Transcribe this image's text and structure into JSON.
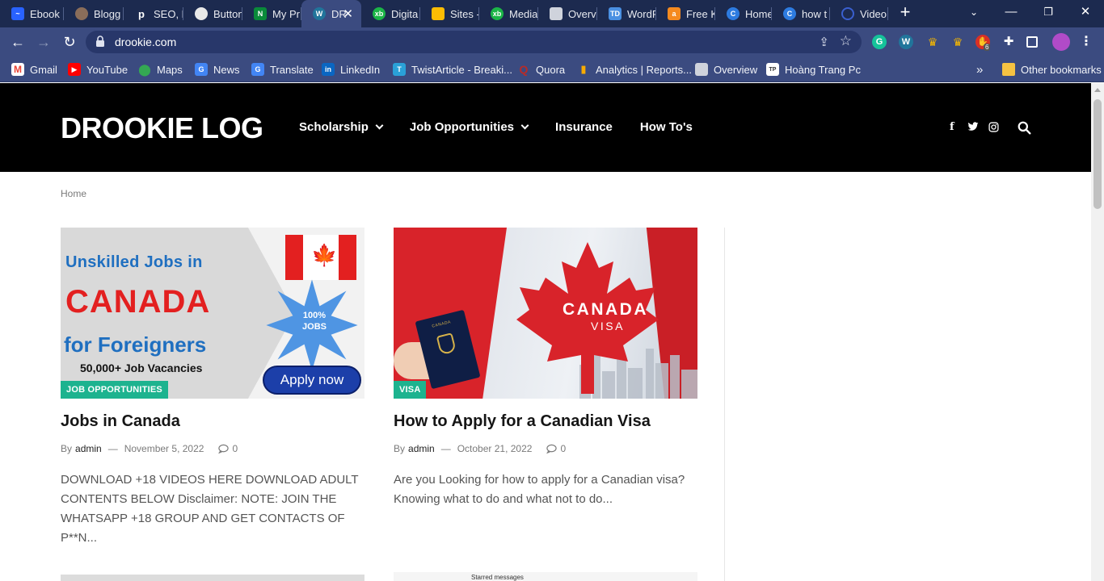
{
  "browser": {
    "tabs": [
      {
        "label": "Ebook",
        "color": "#2962ff"
      },
      {
        "label": "Blogg",
        "color": "#8a6d5a"
      },
      {
        "label": "SEO, E",
        "color": "#1c2a4f"
      },
      {
        "label": "Button",
        "color": "#e8e8e8"
      },
      {
        "label": "My Pr",
        "color": "#0a8a3a"
      },
      {
        "label": "DR",
        "color": "#21759b",
        "active": true
      },
      {
        "label": "Digita",
        "color": "#1bb547"
      },
      {
        "label": "Sites -",
        "color": "#fbbc04"
      },
      {
        "label": "Media",
        "color": "#1bb547"
      },
      {
        "label": "Overv",
        "color": "#cfd3dc"
      },
      {
        "label": "WordP",
        "color": "#4a90e2"
      },
      {
        "label": "Free K",
        "color": "#f58a1f"
      },
      {
        "label": "Home",
        "color": "#2d7be0"
      },
      {
        "label": "how t",
        "color": "#2d7be0"
      },
      {
        "label": "Video",
        "color": "#3a5fcf"
      }
    ],
    "url": "drookie.com",
    "bookmarks": [
      {
        "label": "Gmail",
        "color": "#ea4335",
        "icon": "gmail-icon"
      },
      {
        "label": "YouTube",
        "color": "#ff0000",
        "icon": "youtube-icon"
      },
      {
        "label": "Maps",
        "color": "#34a853",
        "icon": "maps-icon"
      },
      {
        "label": "News",
        "color": "#4285f4",
        "icon": "news-icon"
      },
      {
        "label": "Translate",
        "color": "#4285f4",
        "icon": "translate-icon"
      },
      {
        "label": "LinkedIn",
        "color": "#0a66c2",
        "icon": "linkedin-icon"
      },
      {
        "label": "TwistArticle - Breaki...",
        "color": "#2aa1d8",
        "icon": "twistarticle-icon"
      },
      {
        "label": "Quora",
        "color": "#b92b27",
        "icon": "quora-icon"
      },
      {
        "label": "Analytics | Reports...",
        "color": "#f9ab00",
        "icon": "analytics-icon"
      },
      {
        "label": "Overview",
        "color": "#cfd3dc",
        "icon": "overview-icon"
      },
      {
        "label": "Hoàng Trang Pc",
        "color": "#ffffff",
        "icon": "hoang-trang-icon"
      }
    ],
    "more_bookmarks": "»",
    "other_bookmarks": "Other bookmarks",
    "extension_badge": "6"
  },
  "site": {
    "logo": "DROOKIE LOG",
    "nav": [
      {
        "label": "Scholarship",
        "dropdown": true
      },
      {
        "label": "Job Opportunities",
        "dropdown": true
      },
      {
        "label": "Insurance",
        "dropdown": false
      },
      {
        "label": "How To's",
        "dropdown": false
      }
    ],
    "social": {
      "facebook": "f",
      "twitter": "t",
      "instagram": "ig"
    },
    "breadcrumb": "Home"
  },
  "posts": [
    {
      "category": "JOB OPPORTUNITIES",
      "title": "Jobs in Canada",
      "by": "By",
      "author": "admin",
      "date": "November 5, 2022",
      "comments": "0",
      "excerpt": "DOWNLOAD +18 VIDEOS HERE DOWNLOAD ADULT CONTENTS BELOW Disclaimer: NOTE: JOIN THE WHATSAPP +18 GROUP AND GET CONTACTS OF P**N...",
      "image": {
        "line1": "Unskilled Jobs in",
        "line2": "CANADA",
        "line3": "for Foreigners",
        "line4": "50,000+ Job Vacancies",
        "badge": "100% JOBS",
        "button": "Apply now"
      }
    },
    {
      "category": "VISA",
      "title": "How to Apply for a Canadian Visa",
      "by": "By",
      "author": "admin",
      "date": "October 21, 2022",
      "comments": "0",
      "excerpt": "Are you Looking for how to apply for a Canadian visa? Knowing what to do and what not to do...",
      "image": {
        "line1": "CANADA",
        "line2": "VISA",
        "passport_text": "CANADA"
      }
    }
  ],
  "peek": {
    "text": "Starred messages"
  },
  "colors": {
    "category_bg": "#1db38f",
    "header_bg": "#000000",
    "chrome_bg": "#3b4b80"
  }
}
